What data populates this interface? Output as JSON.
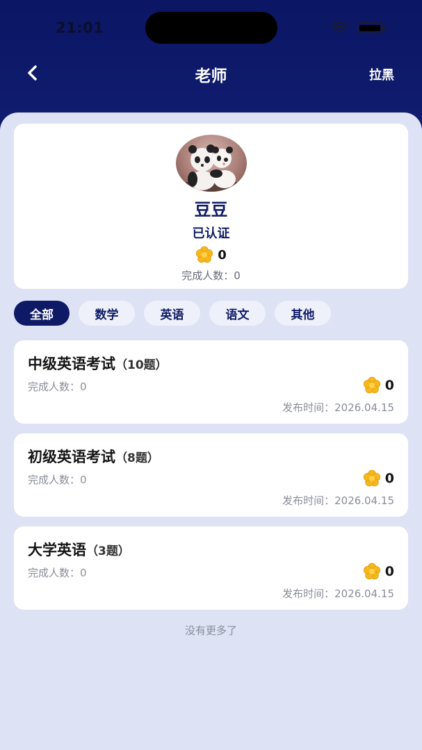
{
  "status_bar": {
    "time": "21:01"
  },
  "nav": {
    "title": "老师",
    "action_label": "拉黑"
  },
  "profile": {
    "name": "豆豆",
    "verified": "已认证",
    "score": "0",
    "completed": "完成人数：0"
  },
  "tabs": [
    {
      "label": "全部",
      "active": true
    },
    {
      "label": "数学",
      "active": false
    },
    {
      "label": "英语",
      "active": false
    },
    {
      "label": "语文",
      "active": false
    },
    {
      "label": "其他",
      "active": false
    }
  ],
  "exams": [
    {
      "title": "中级英语考试",
      "count": "（10题）",
      "completed": "完成人数：0",
      "score": "0",
      "date": "发布时间：2026.04.15"
    },
    {
      "title": "初级英语考试",
      "count": "（8题）",
      "completed": "完成人数：0",
      "score": "0",
      "date": "发布时间：2026.04.15"
    },
    {
      "title": "大学英语",
      "count": "（3题）",
      "completed": "完成人数：0",
      "score": "0",
      "date": "发布时间：2026.04.15"
    }
  ],
  "footer_note": "没有更多了",
  "colors": {
    "primary": "#0e1a66",
    "background": "#dde2f5",
    "card": "#ffffff",
    "flower": "#f5b81c"
  },
  "icons": {
    "back": "chevron-left-icon",
    "score": "flower-icon",
    "wifi": "wifi-icon",
    "battery": "battery-icon"
  }
}
